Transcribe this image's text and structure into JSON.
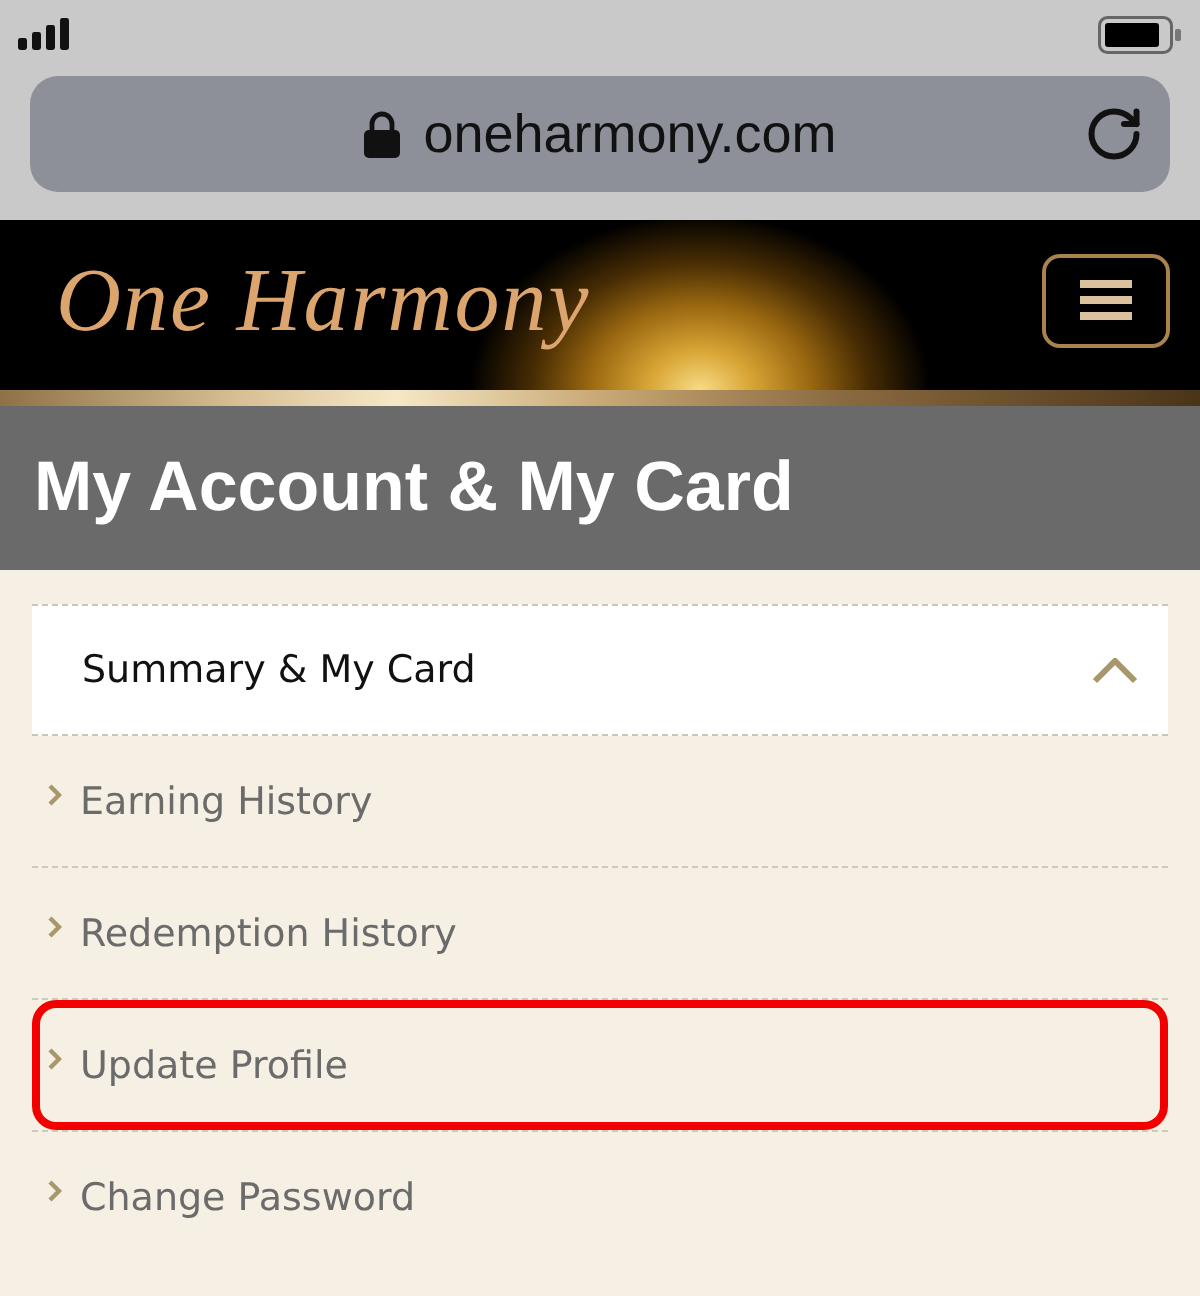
{
  "address_bar": {
    "url": "oneharmony.com",
    "secure": true
  },
  "header": {
    "logo": "One Harmony"
  },
  "page_title": "My Account & My Card",
  "account_menu": {
    "current": "Summary & My Card",
    "expanded": true,
    "items": [
      {
        "label": "Earning History",
        "highlighted": false
      },
      {
        "label": "Redemption History",
        "highlighted": false
      },
      {
        "label": "Update Profile",
        "highlighted": true
      },
      {
        "label": "Change Password",
        "highlighted": false
      }
    ]
  }
}
